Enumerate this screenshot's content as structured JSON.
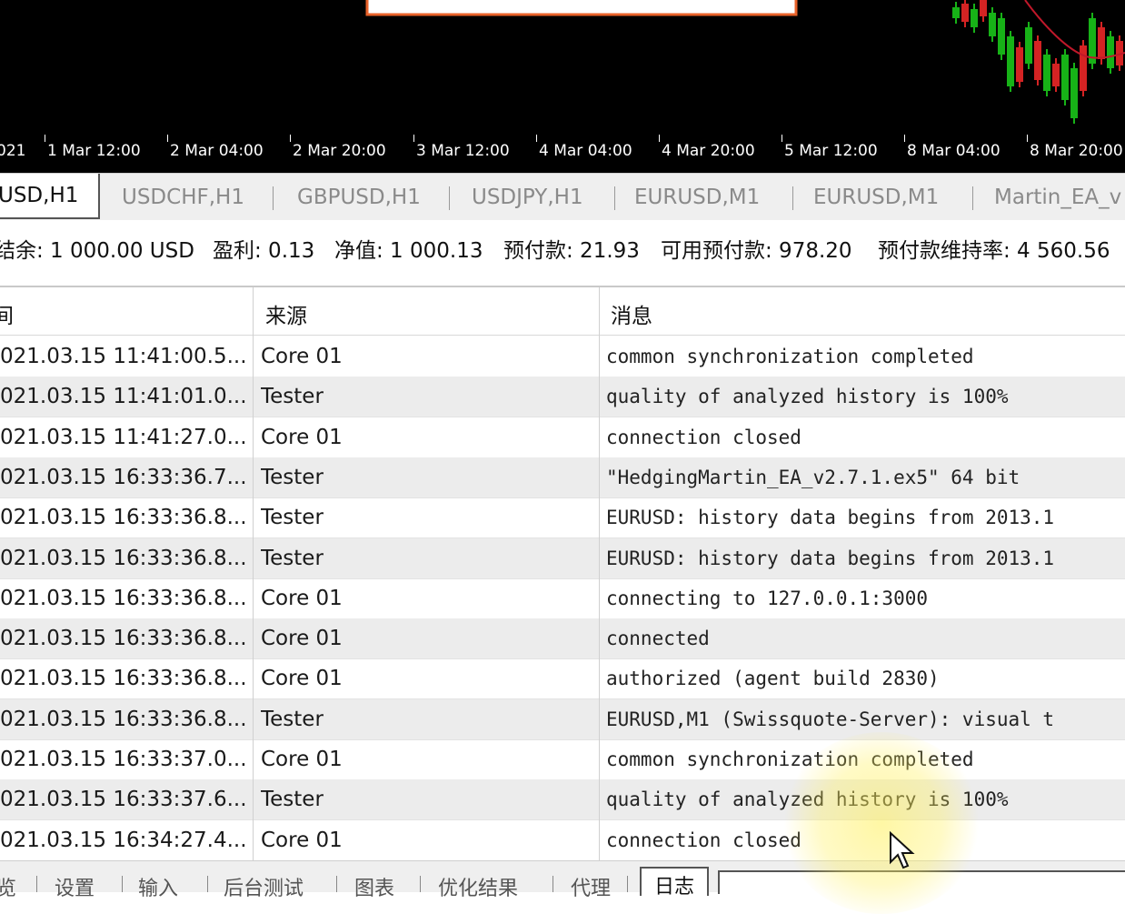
{
  "chart": {
    "time_labels": [
      "021",
      "1 Mar 12:00",
      "2 Mar 04:00",
      "2 Mar 20:00",
      "3 Mar 12:00",
      "4 Mar 04:00",
      "4 Mar 20:00",
      "5 Mar 12:00",
      "8 Mar 04:00",
      "8 Mar 20:00"
    ],
    "colors": {
      "background": "#000000",
      "bull": "#17b217",
      "bear": "#d42323",
      "ma": "#c0182a",
      "dialog_border": "#e8622a"
    }
  },
  "chart_tabs": [
    "USD,H1",
    "USDCHF,H1",
    "GBPUSD,H1",
    "USDJPY,H1",
    "EURUSD,M1",
    "EURUSD,M1",
    "Martin_EA_v"
  ],
  "account": {
    "balance": "结余: 1 000.00 USD",
    "profit": "盈利: 0.13",
    "equity": "净值: 1 000.13",
    "margin": "预付款: 21.93",
    "free_margin": "可用预付款: 978.20",
    "margin_level": "预付款维持率: 4 560.56"
  },
  "journal": {
    "headers": {
      "time": "间",
      "source": "来源",
      "message": "消息"
    },
    "rows": [
      {
        "time": "021.03.15 11:41:00.5...",
        "source": "Core 01",
        "message": "common synchronization completed"
      },
      {
        "time": "021.03.15 11:41:01.0...",
        "source": "Tester",
        "message": "quality of analyzed history is 100%"
      },
      {
        "time": "021.03.15 11:41:27.0...",
        "source": "Core 01",
        "message": "connection closed"
      },
      {
        "time": "021.03.15 16:33:36.7...",
        "source": "Tester",
        "message": "\"HedgingMartin_EA_v2.7.1.ex5\" 64 bit"
      },
      {
        "time": "021.03.15 16:33:36.8...",
        "source": "Tester",
        "message": "EURUSD: history data begins from 2013.1"
      },
      {
        "time": "021.03.15 16:33:36.8...",
        "source": "Tester",
        "message": "EURUSD: history data begins from 2013.1"
      },
      {
        "time": "021.03.15 16:33:36.8...",
        "source": "Core 01",
        "message": "connecting to 127.0.0.1:3000"
      },
      {
        "time": "021.03.15 16:33:36.8...",
        "source": "Core 01",
        "message": "connected"
      },
      {
        "time": "021.03.15 16:33:36.8...",
        "source": "Core 01",
        "message": "authorized (agent build 2830)"
      },
      {
        "time": "021.03.15 16:33:36.8...",
        "source": "Tester",
        "message": "EURUSD,M1 (Swissquote-Server): visual t"
      },
      {
        "time": "021.03.15 16:33:37.0...",
        "source": "Core 01",
        "message": "common synchronization completed"
      },
      {
        "time": "021.03.15 16:33:37.6...",
        "source": "Tester",
        "message": "quality of analyzed history is 100%"
      },
      {
        "time": "021.03.15 16:34:27.4...",
        "source": "Core 01",
        "message": "connection closed"
      }
    ]
  },
  "bottom_tabs": [
    "览",
    "设置",
    "输入",
    "后台测试",
    "图表",
    "优化结果",
    "代理",
    "日志"
  ]
}
